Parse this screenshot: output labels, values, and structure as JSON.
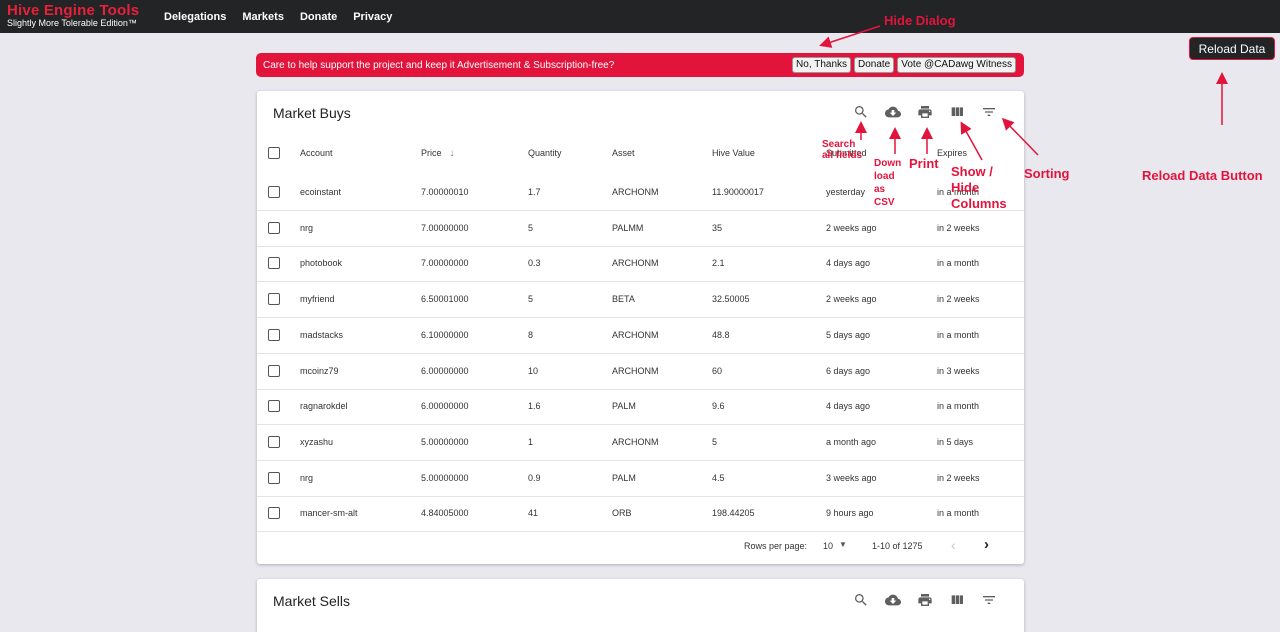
{
  "brand": {
    "title": "Hive Engine Tools",
    "subtitle": "Slightly More Tolerable Edition™"
  },
  "nav": {
    "items": [
      "Delegations",
      "Markets",
      "Donate",
      "Privacy"
    ]
  },
  "banner": {
    "text": "Care to help support the project and keep it Advertisement & Subscription-free?",
    "buttons": [
      "No, Thanks",
      "Donate",
      "Vote @CADawg Witness"
    ]
  },
  "reload": {
    "label": "Reload Data"
  },
  "market_buys": {
    "title": "Market Buys",
    "columns": [
      "Account",
      "Price",
      "Quantity",
      "Asset",
      "Hive Value",
      "Submitted",
      "Expires"
    ],
    "sort_icon": "arrow-down-icon",
    "rows": [
      [
        "ecoinstant",
        "7.00000010",
        "1.7",
        "ARCHONM",
        "11.90000017",
        "yesterday",
        "in a month"
      ],
      [
        "nrg",
        "7.00000000",
        "5",
        "PALMM",
        "35",
        "2 weeks ago",
        "in 2 weeks"
      ],
      [
        "photobook",
        "7.00000000",
        "0.3",
        "ARCHONM",
        "2.1",
        "4 days ago",
        "in a month"
      ],
      [
        "myfriend",
        "6.50001000",
        "5",
        "BETA",
        "32.50005",
        "2 weeks ago",
        "in 2 weeks"
      ],
      [
        "madstacks",
        "6.10000000",
        "8",
        "ARCHONM",
        "48.8",
        "5 days ago",
        "in a month"
      ],
      [
        "mcoinz79",
        "6.00000000",
        "10",
        "ARCHONM",
        "60",
        "6 days ago",
        "in 3 weeks"
      ],
      [
        "ragnarokdel",
        "6.00000000",
        "1.6",
        "PALM",
        "9.6",
        "4 days ago",
        "in a month"
      ],
      [
        "xyzashu",
        "5.00000000",
        "1",
        "ARCHONM",
        "5",
        "a month ago",
        "in 5 days"
      ],
      [
        "nrg",
        "5.00000000",
        "0.9",
        "PALM",
        "4.5",
        "3 weeks ago",
        "in 2 weeks"
      ],
      [
        "mancer-sm-alt",
        "4.84005000",
        "41",
        "ORB",
        "198.44205",
        "9 hours ago",
        "in a month"
      ]
    ],
    "footer": {
      "rows_per_page_label": "Rows per page:",
      "rows_per_page": "10",
      "range": "1-10 of 1275"
    }
  },
  "market_sells": {
    "title": "Market Sells"
  },
  "annotations": {
    "hide_dialog": "Hide Dialog",
    "search": [
      "Search",
      "all fields"
    ],
    "download": [
      "Down",
      "load",
      "as",
      "CSV"
    ],
    "print": "Print",
    "columns": [
      "Show /",
      "Hide",
      "Columns"
    ],
    "sorting": "Sorting",
    "reload": "Reload Data Button"
  },
  "colors": {
    "accent": "#e3143c",
    "nav_bg": "#222426",
    "page_bg": "#e9e8ef"
  }
}
